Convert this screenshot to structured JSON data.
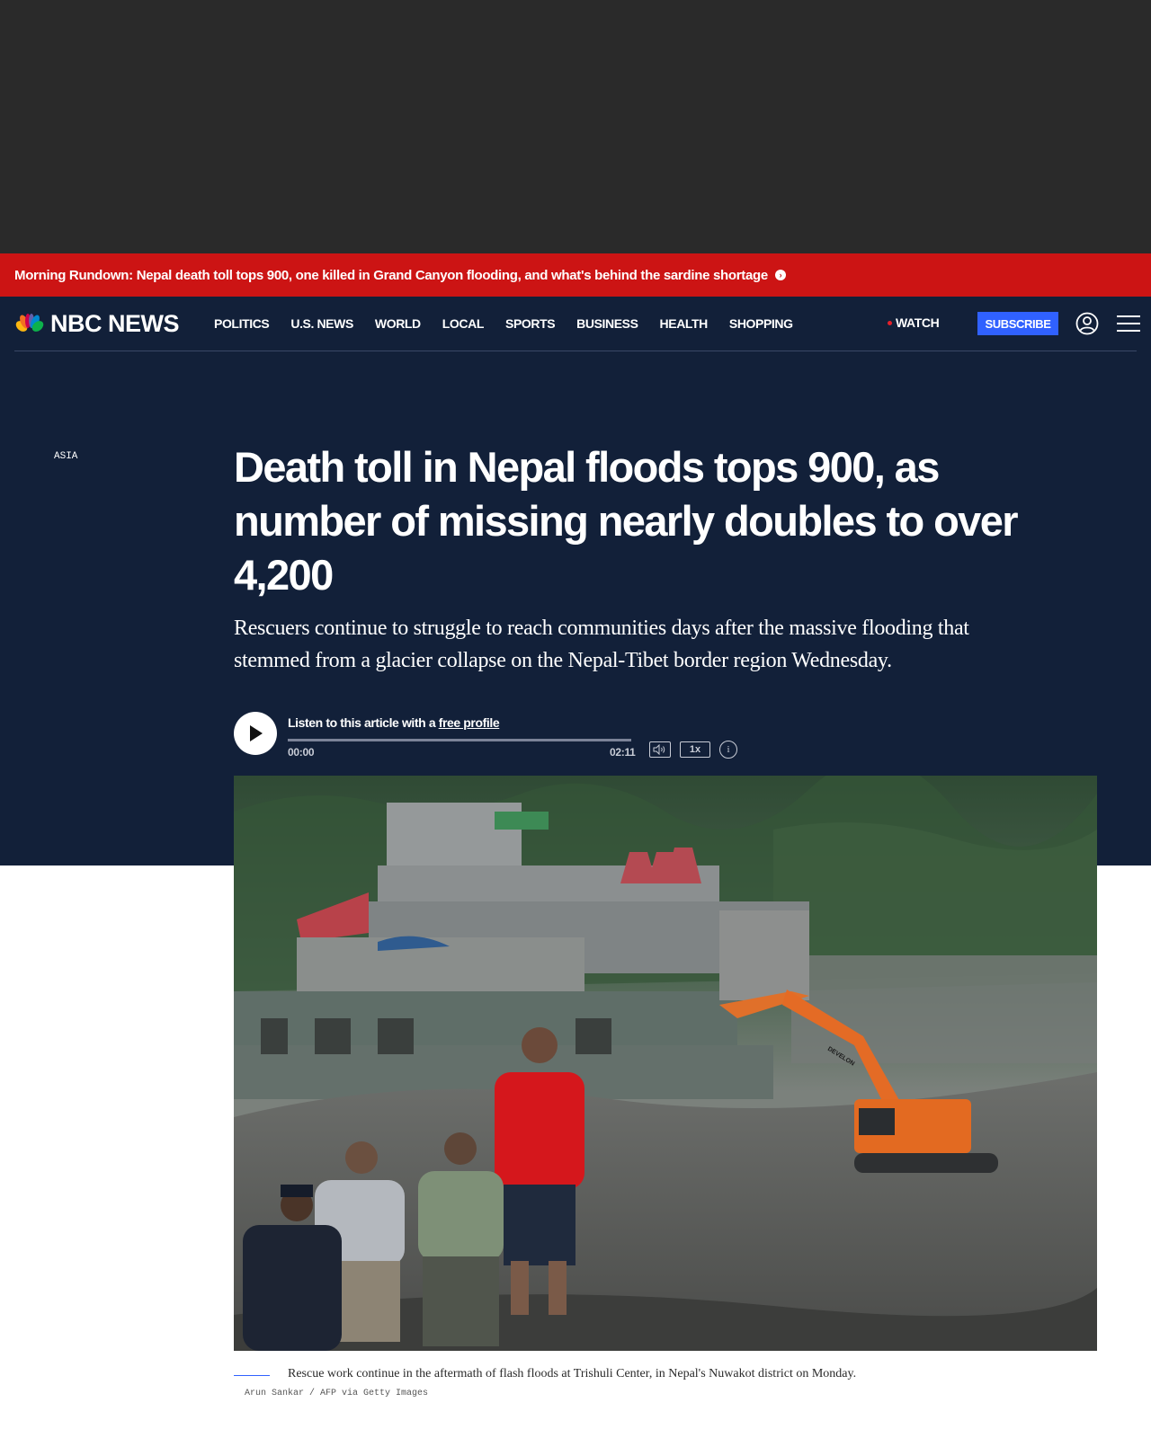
{
  "breaking": {
    "text": "Morning Rundown: Nepal death toll tops 900, one killed in Grand Canyon flooding, and what's behind the sardine shortage"
  },
  "nav": {
    "logo_text": "NBC NEWS",
    "items": [
      {
        "label": "POLITICS"
      },
      {
        "label": "U.S. NEWS"
      },
      {
        "label": "WORLD"
      },
      {
        "label": "LOCAL"
      },
      {
        "label": "SPORTS"
      },
      {
        "label": "BUSINESS"
      },
      {
        "label": "HEALTH"
      },
      {
        "label": "SHOPPING"
      }
    ],
    "watch_label": "WATCH",
    "subscribe_label": "SUBSCRIBE"
  },
  "article": {
    "section": "ASIA",
    "headline": "Death toll in Nepal floods tops 900, as number of missing nearly doubles to over 4,200",
    "dek": "Rescuers continue to struggle to reach communities days after the massive flooding that stemmed from a glacier collapse on the Nepal-Tibet border region Wednesday."
  },
  "player": {
    "listen_prefix": "Listen to this article with a ",
    "listen_link": "free profile",
    "time_start": "00:00",
    "time_end": "02:11",
    "speed": "1x",
    "info": "i",
    "progress": 0
  },
  "image": {
    "caption": "Rescue work continue in the aftermath of flash floods at Trishuli Center, in Nepal's Nuwakot district on Monday.",
    "credit": "Arun Sankar / AFP via Getty Images",
    "machine_text": "DEVELON"
  },
  "colors": {
    "breaking_bar": "#cc1414",
    "header_bg": "#122039",
    "subscribe": "#3061ff",
    "ad_space": "#2a2a2a"
  }
}
